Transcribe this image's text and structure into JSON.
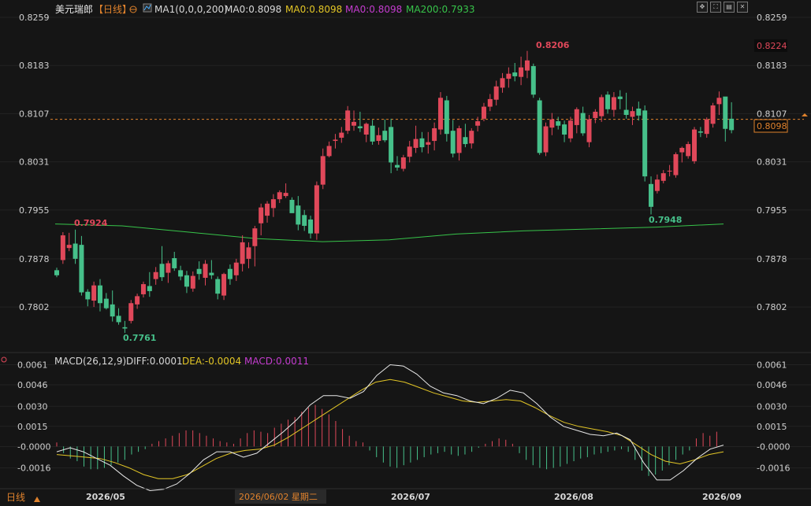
{
  "header": {
    "instrument": "美元瑞郎",
    "period": "【日线】",
    "ma_label": "MA1(0,0,0,200)",
    "ma_values": [
      {
        "text": "MA0:0.8098",
        "color": "#d8d8d8"
      },
      {
        "text": "MA0:0.8098",
        "color": "#e3c626"
      },
      {
        "text": "MA0:0.8098",
        "color": "#c43ccf"
      },
      {
        "text": "MA200:0.7933",
        "color": "#37c44a"
      }
    ]
  },
  "toolbar": {
    "icons": [
      "move-icon",
      "expand-icon",
      "split-icon",
      "close-icon"
    ]
  },
  "price_axis": {
    "ticks": [
      "0.8259",
      "0.8183",
      "0.8107",
      "0.8031",
      "0.7955",
      "0.7878",
      "0.7802"
    ],
    "current_price": "0.8098",
    "highlight_price": "0.8224"
  },
  "annotations": {
    "high": "0.8206",
    "low": "0.7761",
    "left_high": "0.7924",
    "swing_low": "0.7948"
  },
  "macd_header": {
    "label": "MACD(26,12,9)",
    "diff": "DIFF:0.0001",
    "dea": "DEA:-0.0004",
    "macd": "MACD:0.0011"
  },
  "macd_axis": {
    "ticks": [
      "0.0061",
      "0.0046",
      "0.0030",
      "0.0015",
      "-0.0000",
      "-0.0016"
    ]
  },
  "date_axis": {
    "labels": [
      "2026/05",
      "2026/07",
      "2026/08",
      "2026/09"
    ],
    "cursor_label": "2026/06/02 星期二",
    "period_tab": "日线"
  },
  "colors": {
    "up": "#e0485a",
    "down": "#46c08a",
    "ma200": "#37c44a",
    "diff": "#e8e8e8",
    "dea": "#e3c626"
  },
  "chart_data": [
    {
      "type": "candlestick",
      "title": "美元瑞郎 【日线】",
      "ylim": [
        0.774,
        0.8259
      ],
      "x_labels": [
        "2026/05",
        "2026/07",
        "2026/08",
        "2026/09"
      ],
      "candles": [
        [
          0.786,
          0.7864,
          0.7849,
          0.7852
        ],
        [
          0.7876,
          0.792,
          0.787,
          0.7915
        ],
        [
          0.7895,
          0.7919,
          0.789,
          0.79
        ],
        [
          0.7902,
          0.7924,
          0.787,
          0.7878
        ],
        [
          0.79,
          0.7914,
          0.782,
          0.7825
        ],
        [
          0.7826,
          0.783,
          0.7803,
          0.7814
        ],
        [
          0.7812,
          0.7842,
          0.7802,
          0.7836
        ],
        [
          0.7836,
          0.7846,
          0.7795,
          0.7808
        ],
        [
          0.7815,
          0.7824,
          0.7798,
          0.78
        ],
        [
          0.7806,
          0.7828,
          0.7779,
          0.7787
        ],
        [
          0.7788,
          0.78,
          0.7774,
          0.7778
        ],
        [
          0.777,
          0.778,
          0.7761,
          0.7768
        ],
        [
          0.778,
          0.7813,
          0.7776,
          0.7808
        ],
        [
          0.7806,
          0.7823,
          0.7799,
          0.7819
        ],
        [
          0.7822,
          0.7842,
          0.7817,
          0.7838
        ],
        [
          0.7835,
          0.7857,
          0.7818,
          0.7827
        ],
        [
          0.7846,
          0.7865,
          0.7837,
          0.7857
        ],
        [
          0.787,
          0.7898,
          0.7843,
          0.7849
        ],
        [
          0.7856,
          0.7875,
          0.784,
          0.7871
        ],
        [
          0.7879,
          0.7889,
          0.7859,
          0.7863
        ],
        [
          0.786,
          0.7867,
          0.7844,
          0.785
        ],
        [
          0.7852,
          0.7859,
          0.7824,
          0.7834
        ],
        [
          0.7831,
          0.7858,
          0.7826,
          0.7851
        ],
        [
          0.7862,
          0.7874,
          0.7845,
          0.7854
        ],
        [
          0.7848,
          0.7876,
          0.7836,
          0.787
        ],
        [
          0.7856,
          0.7876,
          0.7846,
          0.7852
        ],
        [
          0.7846,
          0.785,
          0.7814,
          0.7823
        ],
        [
          0.782,
          0.7856,
          0.7813,
          0.7854
        ],
        [
          0.7862,
          0.7869,
          0.7837,
          0.7846
        ],
        [
          0.7852,
          0.7878,
          0.7843,
          0.7872
        ],
        [
          0.787,
          0.7915,
          0.7858,
          0.7904
        ],
        [
          0.7878,
          0.7904,
          0.7863,
          0.7896
        ],
        [
          0.7898,
          0.793,
          0.7866,
          0.7926
        ],
        [
          0.7934,
          0.7965,
          0.7915,
          0.7959
        ],
        [
          0.7946,
          0.7969,
          0.7935,
          0.7965
        ],
        [
          0.7958,
          0.798,
          0.7944,
          0.7972
        ],
        [
          0.7972,
          0.7986,
          0.7966,
          0.7983
        ],
        [
          0.7977,
          0.7997,
          0.7974,
          0.7982
        ],
        [
          0.7971,
          0.7975,
          0.7953,
          0.795
        ],
        [
          0.7962,
          0.7977,
          0.7923,
          0.7932
        ],
        [
          0.7947,
          0.7955,
          0.7922,
          0.793
        ],
        [
          0.794,
          0.7946,
          0.791,
          0.7918
        ],
        [
          0.7918,
          0.8,
          0.7908,
          0.7994
        ],
        [
          0.7995,
          0.8052,
          0.7988,
          0.804
        ],
        [
          0.804,
          0.8063,
          0.8038,
          0.8056
        ],
        [
          0.8064,
          0.8075,
          0.8052,
          0.8066
        ],
        [
          0.8069,
          0.8086,
          0.8061,
          0.8077
        ],
        [
          0.808,
          0.8119,
          0.8075,
          0.8112
        ],
        [
          0.8088,
          0.8112,
          0.808,
          0.8094
        ],
        [
          0.8087,
          0.811,
          0.8078,
          0.8084
        ],
        [
          0.8074,
          0.8093,
          0.8062,
          0.8091
        ],
        [
          0.8088,
          0.8097,
          0.8058,
          0.8063
        ],
        [
          0.8064,
          0.8085,
          0.8058,
          0.8073
        ],
        [
          0.808,
          0.8098,
          0.8062,
          0.8065
        ],
        [
          0.8086,
          0.8099,
          0.8013,
          0.803
        ],
        [
          0.8026,
          0.804,
          0.8017,
          0.8022
        ],
        [
          0.802,
          0.8042,
          0.8016,
          0.8038
        ],
        [
          0.8039,
          0.8064,
          0.803,
          0.8055
        ],
        [
          0.8053,
          0.8088,
          0.8045,
          0.8067
        ],
        [
          0.8068,
          0.8078,
          0.8046,
          0.8054
        ],
        [
          0.8058,
          0.8078,
          0.8044,
          0.8062
        ],
        [
          0.8064,
          0.8093,
          0.8049,
          0.8084
        ],
        [
          0.8082,
          0.8141,
          0.8074,
          0.8132
        ],
        [
          0.8128,
          0.8135,
          0.8063,
          0.8075
        ],
        [
          0.808,
          0.8097,
          0.8038,
          0.8044
        ],
        [
          0.8045,
          0.8088,
          0.8033,
          0.8084
        ],
        [
          0.807,
          0.8091,
          0.8054,
          0.8059
        ],
        [
          0.806,
          0.8084,
          0.8052,
          0.808
        ],
        [
          0.8088,
          0.8102,
          0.8079,
          0.8095
        ],
        [
          0.8099,
          0.8124,
          0.8095,
          0.8118
        ],
        [
          0.8118,
          0.8138,
          0.8111,
          0.813
        ],
        [
          0.8129,
          0.8159,
          0.812,
          0.815
        ],
        [
          0.8148,
          0.8171,
          0.814,
          0.8163
        ],
        [
          0.8162,
          0.818,
          0.8148,
          0.817
        ],
        [
          0.8172,
          0.8187,
          0.8158,
          0.8166
        ],
        [
          0.8165,
          0.8197,
          0.8152,
          0.818
        ],
        [
          0.8175,
          0.8206,
          0.8163,
          0.8191
        ],
        [
          0.8182,
          0.8186,
          0.8132,
          0.8137
        ],
        [
          0.8128,
          0.8132,
          0.8042,
          0.8045
        ],
        [
          0.8046,
          0.8093,
          0.804,
          0.8087
        ],
        [
          0.8085,
          0.8108,
          0.8073,
          0.8098
        ],
        [
          0.8095,
          0.8102,
          0.8082,
          0.8088
        ],
        [
          0.809,
          0.8096,
          0.8062,
          0.8074
        ],
        [
          0.8068,
          0.8102,
          0.8062,
          0.8096
        ],
        [
          0.8089,
          0.8117,
          0.8076,
          0.8114
        ],
        [
          0.8108,
          0.8118,
          0.8072,
          0.8076
        ],
        [
          0.8062,
          0.8105,
          0.8054,
          0.8098
        ],
        [
          0.81,
          0.8114,
          0.8092,
          0.811
        ],
        [
          0.8103,
          0.8137,
          0.8094,
          0.8133
        ],
        [
          0.8137,
          0.8142,
          0.8107,
          0.8114
        ],
        [
          0.8113,
          0.8141,
          0.8102,
          0.8133
        ],
        [
          0.8134,
          0.8144,
          0.8114,
          0.813
        ],
        [
          0.8113,
          0.814,
          0.8099,
          0.8105
        ],
        [
          0.8102,
          0.8118,
          0.8089,
          0.8111
        ],
        [
          0.8115,
          0.8126,
          0.8096,
          0.8104
        ],
        [
          0.8112,
          0.812,
          0.8,
          0.8008
        ],
        [
          0.7996,
          0.8008,
          0.7948,
          0.796
        ],
        [
          0.7985,
          0.8011,
          0.7981,
          0.8003
        ],
        [
          0.8001,
          0.8018,
          0.7997,
          0.8013
        ],
        [
          0.8016,
          0.8026,
          0.8008,
          0.8017
        ],
        [
          0.801,
          0.8046,
          0.8006,
          0.8043
        ],
        [
          0.8046,
          0.8055,
          0.803,
          0.8053
        ],
        [
          0.804,
          0.8063,
          0.8036,
          0.8059
        ],
        [
          0.8032,
          0.8086,
          0.8028,
          0.8082
        ],
        [
          0.8079,
          0.8086,
          0.807,
          0.8077
        ],
        [
          0.8075,
          0.8101,
          0.8069,
          0.8098
        ],
        [
          0.8091,
          0.8124,
          0.8085,
          0.812
        ],
        [
          0.8122,
          0.8142,
          0.8105,
          0.8132
        ],
        [
          0.8134,
          0.8129,
          0.8063,
          0.8083
        ],
        [
          0.8099,
          0.8125,
          0.8076,
          0.8081
        ]
      ],
      "ma200": [
        0.7933,
        0.793,
        0.792,
        0.791,
        0.7905,
        0.7908,
        0.7917,
        0.7922,
        0.7925,
        0.7928,
        0.7933
      ]
    },
    {
      "type": "macd",
      "title": "MACD(26,12,9)",
      "ylim": [
        -0.0028,
        0.0066
      ],
      "diff": [
        -0.0004,
        -0.0001,
        -0.0004,
        -0.0009,
        -0.0014,
        -0.0022,
        -0.0029,
        -0.0033,
        -0.0032,
        -0.0028,
        -0.002,
        -0.001,
        -0.0004,
        -0.0004,
        -0.0008,
        -0.0005,
        0.0003,
        0.0011,
        0.002,
        0.0031,
        0.0038,
        0.0038,
        0.0036,
        0.0041,
        0.0053,
        0.0061,
        0.006,
        0.0054,
        0.0045,
        0.004,
        0.0038,
        0.0034,
        0.0032,
        0.0036,
        0.0042,
        0.004,
        0.0032,
        0.0022,
        0.0015,
        0.0012,
        0.0009,
        0.0008,
        0.001,
        0.0005,
        -0.0012,
        -0.0025,
        -0.0025,
        -0.0018,
        -0.0009,
        -0.0002,
        0.0001
      ],
      "dea": [
        -0.0006,
        -0.0007,
        -0.0008,
        -0.0009,
        -0.0012,
        -0.0016,
        -0.0021,
        -0.0024,
        -0.0024,
        -0.0021,
        -0.0015,
        -0.0009,
        -0.0005,
        -0.0003,
        -0.0002,
        0.0001,
        0.0007,
        0.0014,
        0.0021,
        0.0028,
        0.0035,
        0.0042,
        0.0048,
        0.005,
        0.0048,
        0.0044,
        0.004,
        0.0037,
        0.0034,
        0.0033,
        0.0034,
        0.0035,
        0.0034,
        0.0029,
        0.0023,
        0.0018,
        0.0015,
        0.0013,
        0.0011,
        0.0008,
        0.0001,
        -0.0006,
        -0.0011,
        -0.0013,
        -0.001,
        -0.0006,
        -0.0004
      ],
      "histogram": [
        0.0003,
        -0.0005,
        -0.0009,
        -0.0011,
        -0.0015,
        -0.0017,
        -0.0017,
        -0.0016,
        -0.0014,
        -0.0012,
        -0.001,
        -0.0006,
        -0.0004,
        -0.0002,
        0.0002,
        0.0004,
        0.0006,
        0.0008,
        0.001,
        0.0012,
        0.0012,
        0.001,
        0.0008,
        0.0006,
        0.0004,
        0.0003,
        0.0002,
        0.0006,
        0.001,
        0.0012,
        0.0011,
        0.001,
        0.0014,
        0.0017,
        0.002,
        0.0022,
        0.0026,
        0.0029,
        0.0031,
        0.0028,
        0.0024,
        0.0019,
        0.0013,
        0.0008,
        0.0004,
        0.0003,
        -0.0003,
        -0.0008,
        -0.0012,
        -0.0015,
        -0.0016,
        -0.0014,
        -0.0012,
        -0.001,
        -0.0008,
        -0.0006,
        -0.0005,
        -0.0004,
        -0.0006,
        -0.0007,
        -0.0006,
        -0.0004,
        -0.0001,
        0.0002,
        0.0004,
        0.0006,
        0.0005,
        0.0002,
        -0.0005,
        -0.001,
        -0.0014,
        -0.0016,
        -0.0017,
        -0.0016,
        -0.0015,
        -0.0013,
        -0.0011,
        -0.0009,
        -0.0008,
        -0.0006,
        -0.0005,
        -0.0004,
        -0.0003,
        -0.0002,
        -0.0004,
        -0.001,
        -0.0018,
        -0.0022,
        -0.0021,
        -0.0018,
        -0.0014,
        -0.001,
        -0.0006,
        -0.0003,
        0.0006,
        0.001,
        0.0008,
        0.0011
      ]
    }
  ]
}
